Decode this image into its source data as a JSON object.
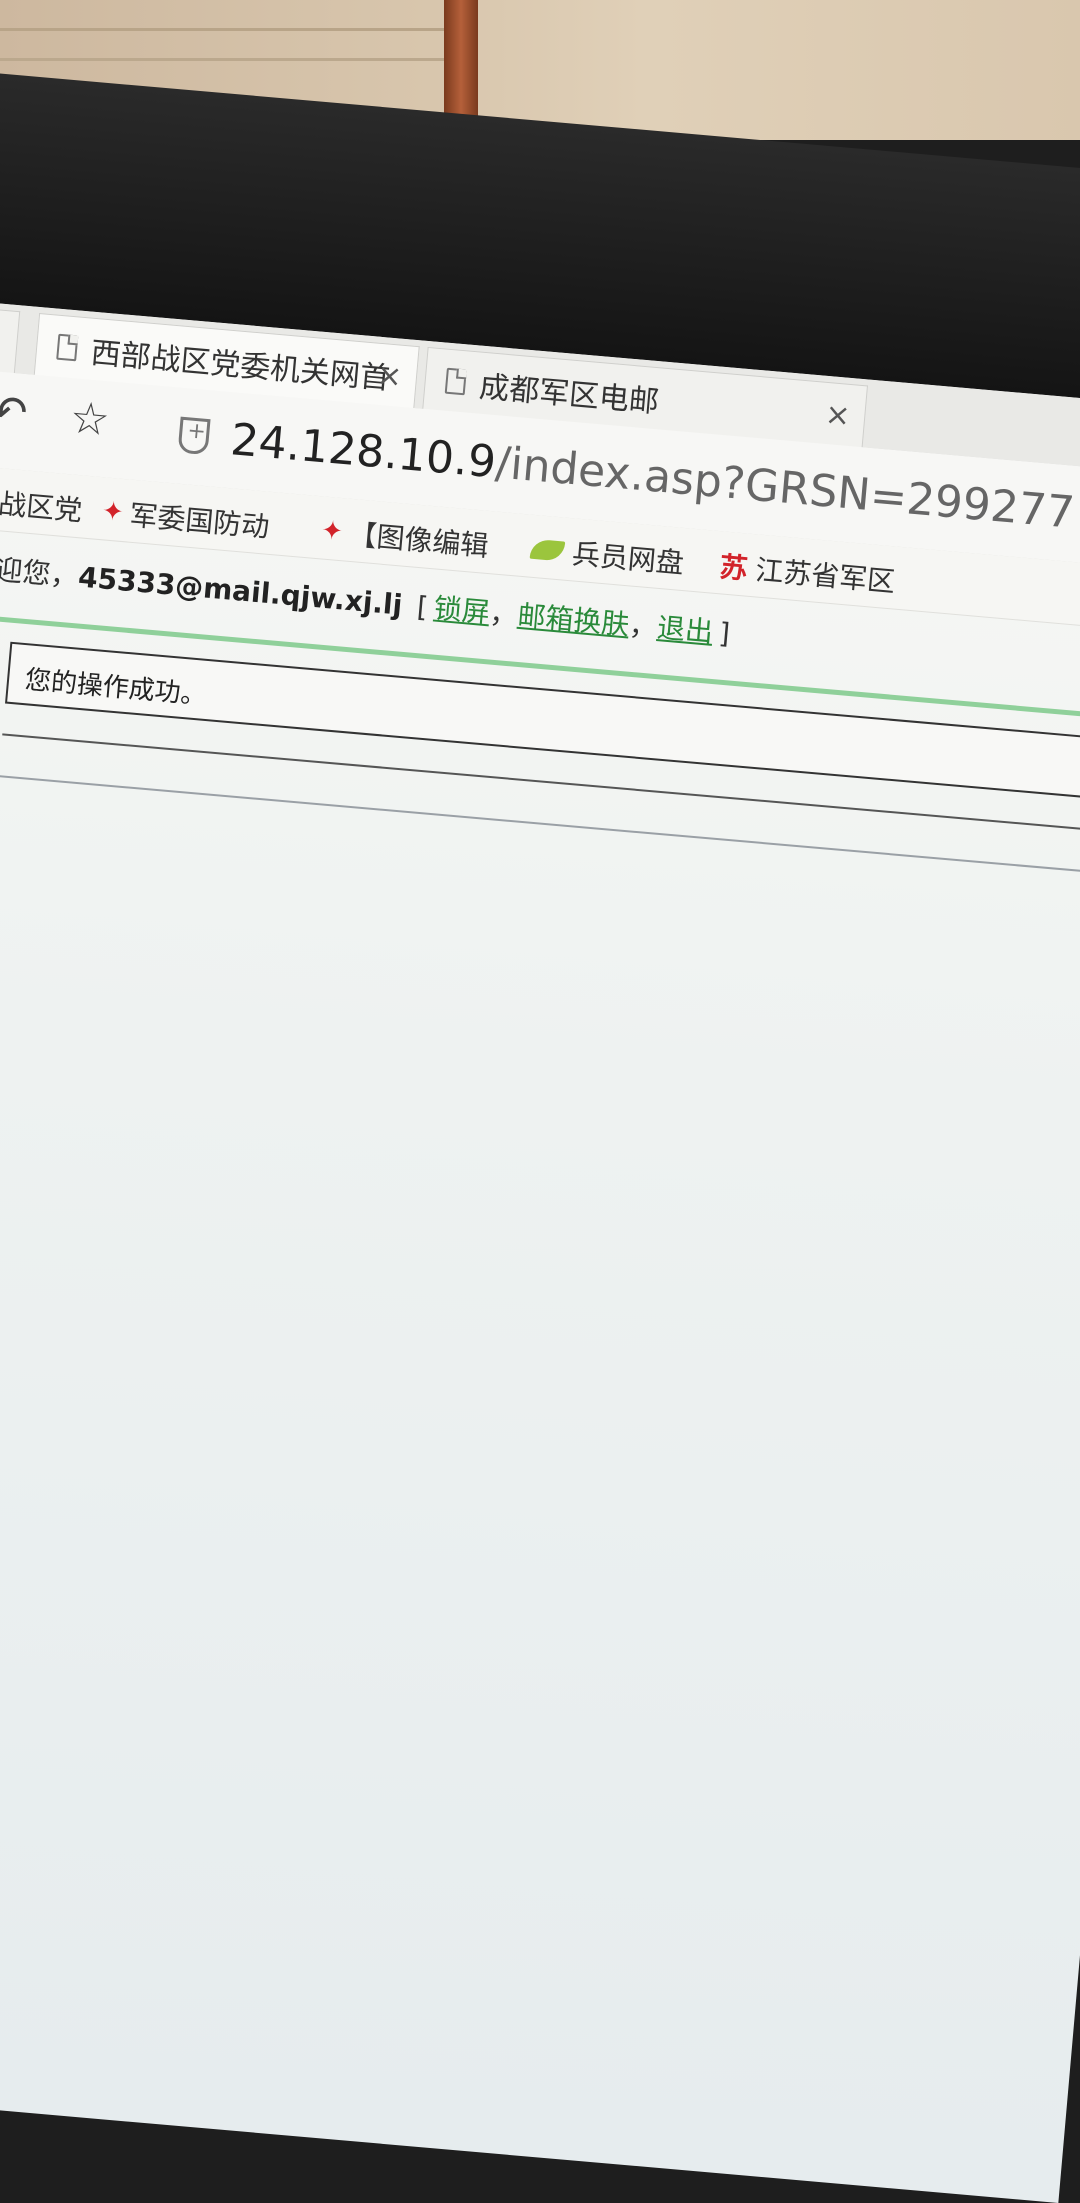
{
  "tabs": [
    {
      "label": "西部战区党委机关网首"
    },
    {
      "label": "成都军区电邮"
    }
  ],
  "tab_close_glyph": "×",
  "toolbar": {
    "undo_icon": "undo-icon",
    "star_icon": "star-icon",
    "address_host": "24.128.10.9",
    "address_path": "/index.asp?GRSN=299277"
  },
  "bookmarks": [
    {
      "label": "西部战区党",
      "icon": "none"
    },
    {
      "label": "军委国防动",
      "icon": "red-star-icon"
    },
    {
      "label": "【图像编辑",
      "icon": "red-star-icon"
    },
    {
      "label": "兵员网盘",
      "icon": "leaf-icon"
    },
    {
      "label": "江苏省军区",
      "icon": "su-icon"
    }
  ],
  "bookmark_su_glyph": "苏",
  "header": {
    "welcome_prefix": "欢迎您，",
    "email": "45333@mail.qjw.xj.lj",
    "bracket_open": "[",
    "bracket_close": "]",
    "sep": "，",
    "links": [
      "锁屏",
      "邮箱换肤",
      "退出"
    ]
  },
  "notice": {
    "message": "您的操作成功。"
  },
  "colors": {
    "link": "#2a8a3a",
    "accent_bar": "#8fd09a",
    "bookmark_star": "#d2232a"
  }
}
